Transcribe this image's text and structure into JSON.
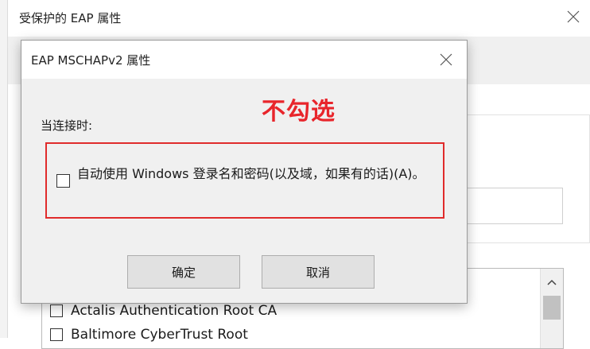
{
  "background_window": {
    "title": "受保护的 EAP 属性",
    "certificates": [
      "Actalis Authentication Root CA",
      "Baltimore CyberTrust Root"
    ]
  },
  "dialog": {
    "title": "EAP MSCHAPv2 属性",
    "annotation": "不勾选",
    "annotation_color": "#e8252b",
    "connect_label": "当连接时:",
    "auto_checkbox": {
      "label": "自动使用 Windows 登录名和密码(以及域，如果有的话)(A)。",
      "checked": false
    },
    "ok_label": "确定",
    "cancel_label": "取消"
  },
  "icons": {
    "close": "close-icon",
    "scroll_up": "chevron-up-icon"
  }
}
